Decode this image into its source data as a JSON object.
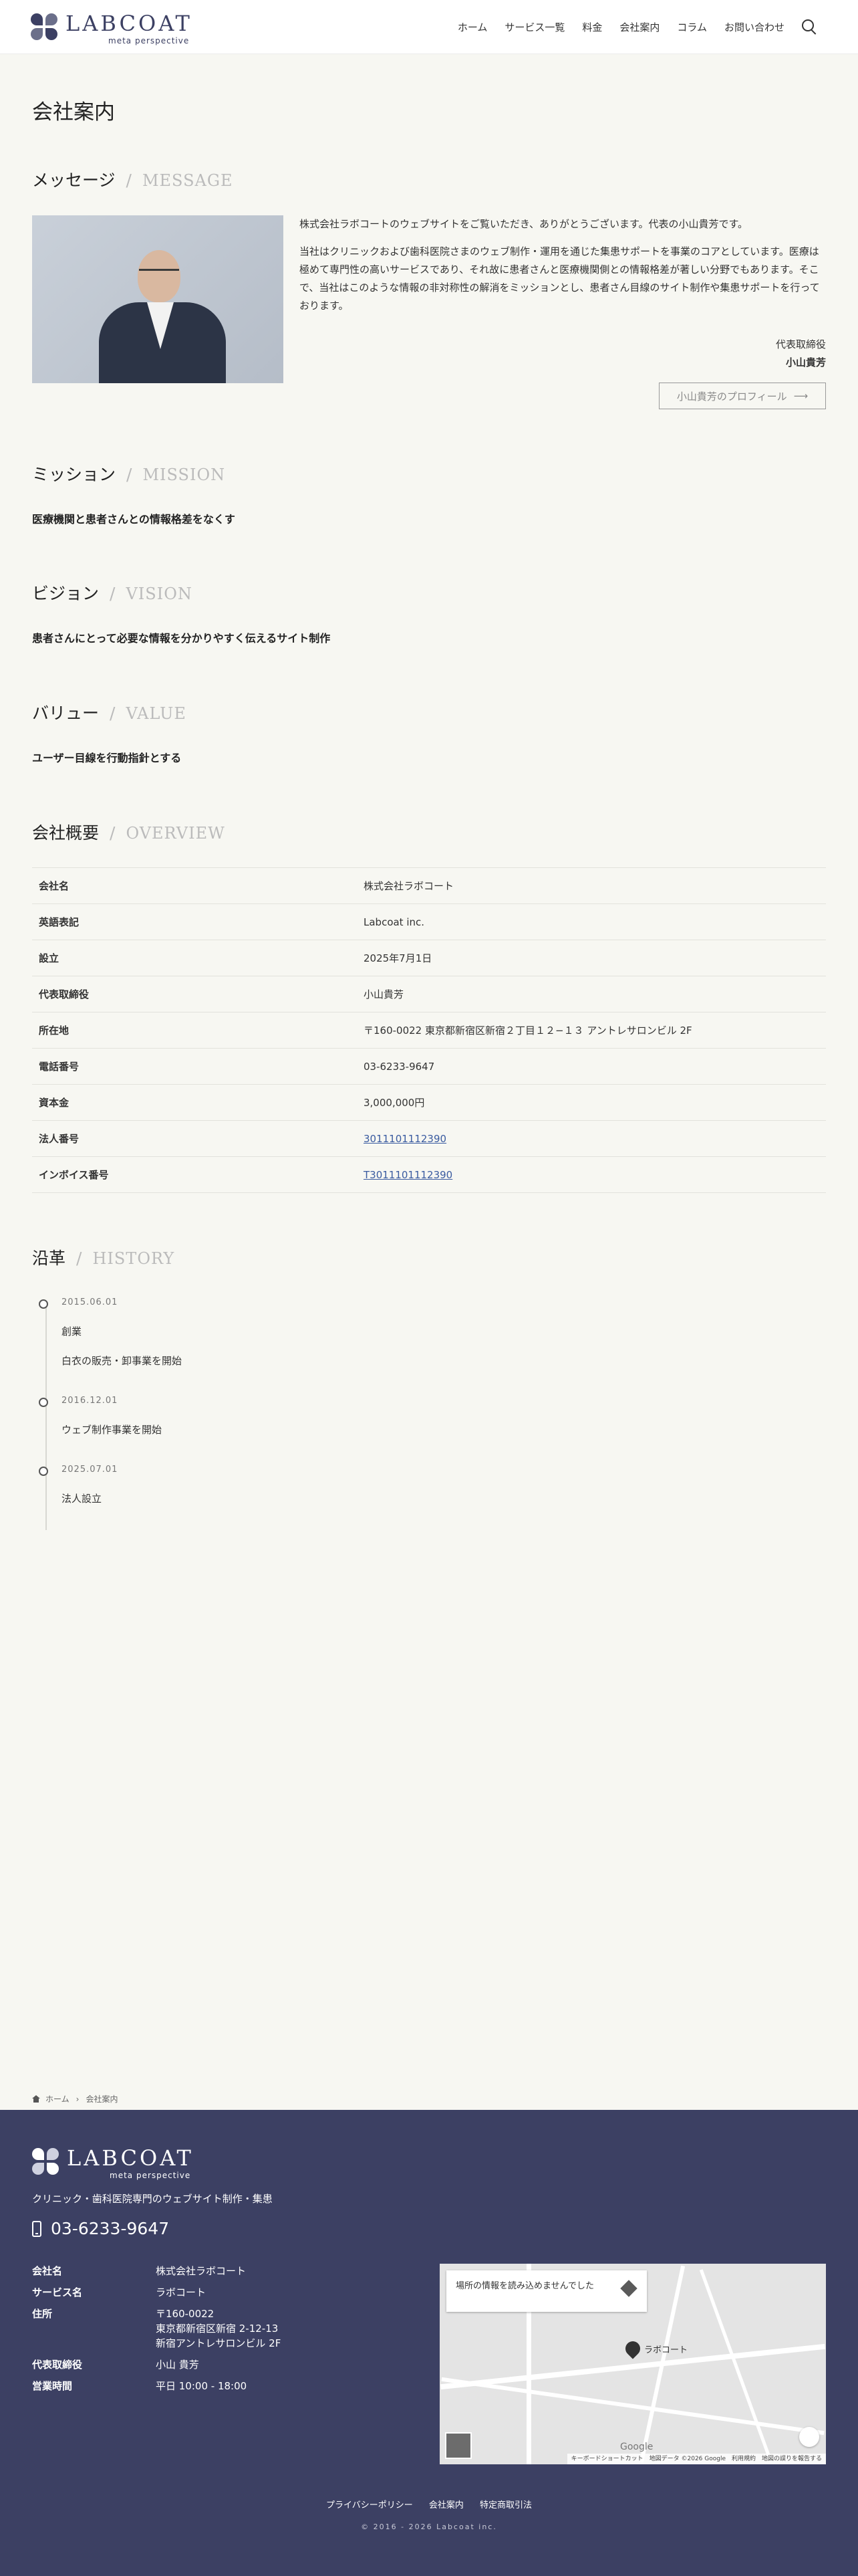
{
  "header": {
    "logo_text": "LABCOAT",
    "logo_tagline": "meta perspective",
    "nav": [
      "ホーム",
      "サービス一覧",
      "料金",
      "会社案内",
      "コラム",
      "お問い合わせ"
    ]
  },
  "page_title": "会社案内",
  "message": {
    "heading": "メッセージ",
    "heading_en": "MESSAGE",
    "paragraphs": [
      "株式会社ラボコートのウェブサイトをご覧いただき、ありがとうございます。代表の小山貴芳です。",
      "当社はクリニックおよび歯科医院さまのウェブ制作・運用を通じた集患サポートを事業のコアとしています。医療は極めて専門性の高いサービスであり、それ故に患者さんと医療機関側との情報格差が著しい分野でもあります。そこで、当社はこのような情報の非対称性の解消をミッションとし、患者さん目線のサイト制作や集患サポートを行っております。"
    ],
    "signature_title": "代表取締役",
    "signature_name": "小山貴芳",
    "profile_button": "小山貴芳のプロフィール"
  },
  "mission": {
    "heading": "ミッション",
    "heading_en": "MISSION",
    "text": "医療機関と患者さんとの情報格差をなくす"
  },
  "vision": {
    "heading": "ビジョン",
    "heading_en": "VISION",
    "text": "患者さんにとって必要な情報を分かりやすく伝えるサイト制作"
  },
  "value": {
    "heading": "バリュー",
    "heading_en": "VALUE",
    "text": "ユーザー目線を行動指針とする"
  },
  "overview": {
    "heading": "会社概要",
    "heading_en": "OVERVIEW",
    "rows": [
      {
        "key": "会社名",
        "value": "株式会社ラボコート"
      },
      {
        "key": "英語表記",
        "value": "Labcoat inc."
      },
      {
        "key": "設立",
        "value": "2025年7月1日"
      },
      {
        "key": "代表取締役",
        "value": "小山貴芳"
      },
      {
        "key": "所在地",
        "value": "〒160-0022 東京都新宿区新宿２丁目１２−１３ アントレサロンビル 2F"
      },
      {
        "key": "電話番号",
        "value": "03-6233-9647"
      },
      {
        "key": "資本金",
        "value": "3,000,000円"
      },
      {
        "key": "法人番号",
        "value": "3011101112390"
      },
      {
        "key": "インボイス番号",
        "value": "T3011101112390"
      }
    ]
  },
  "history": {
    "heading": "沿革",
    "heading_en": "HISTORY",
    "items": [
      {
        "date": "2015.06.01",
        "lines": [
          "創業",
          "白衣の販売・卸事業を開始"
        ]
      },
      {
        "date": "2016.12.01",
        "lines": [
          "ウェブ制作事業を開始"
        ]
      },
      {
        "date": "2025.07.01",
        "lines": [
          "法人設立"
        ]
      }
    ]
  },
  "breadcrumb": {
    "home": "ホーム",
    "current": "会社案内"
  },
  "footer": {
    "tagline": "クリニック・歯科医院専門のウェブサイト制作・集患",
    "phone": "03-6233-9647",
    "info": [
      {
        "key": "会社名",
        "value": "株式会社ラボコート"
      },
      {
        "key": "サービス名",
        "value": "ラボコート"
      },
      {
        "key": "住所",
        "lines": [
          "〒160-0022",
          "東京都新宿区新宿 2-12-13",
          "新宿アントレサロンビル 2F"
        ]
      },
      {
        "key": "代表取締役",
        "value": "小山 貴芳"
      },
      {
        "key": "営業時間",
        "value": "平日 10:00 - 18:00"
      }
    ],
    "map": {
      "popup_text": "場所の情報を読み込めませんでした",
      "pin_label": "ラボコート",
      "credit": "キーボードショートカット　地図データ ©2026 Google　利用規約　地図の誤りを報告する",
      "google_label": "Google"
    },
    "links": [
      "プライバシーポリシー",
      "会社案内",
      "特定商取引法"
    ],
    "copyright": "© 2016 - 2026 Labcoat inc."
  }
}
